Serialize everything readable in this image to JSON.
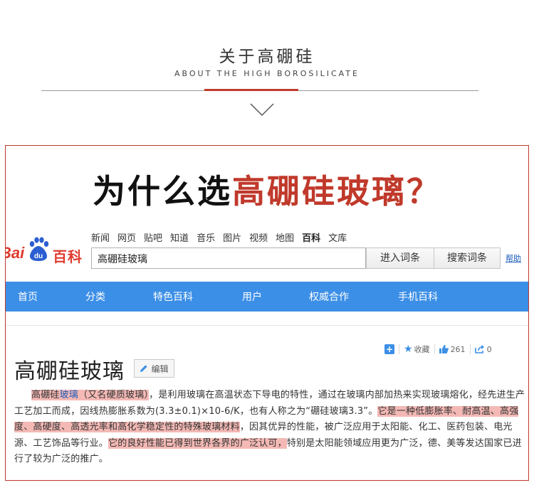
{
  "header": {
    "title": "关于高硼硅",
    "subtitle": "ABOUT THE HIGH BOROSILICATE"
  },
  "question": {
    "prefix": "为什么选",
    "highlight": "高硼硅玻璃？"
  },
  "baidu": {
    "logo_left": "Bai",
    "logo_paw_text": "du",
    "logo_right": "百科",
    "nav_links": [
      "新闻",
      "网页",
      "贴吧",
      "知道",
      "音乐",
      "图片",
      "视频",
      "地图",
      "百科",
      "文库"
    ],
    "active_nav": "百科",
    "search_value": "高硼硅玻璃",
    "enter_button": "进入词条",
    "search_button": "搜索词条",
    "help_link": "帮助",
    "blue_nav": [
      "首页",
      "分类",
      "特色百科",
      "用户",
      "权威合作",
      "手机百科"
    ]
  },
  "entry": {
    "title": "高硼硅玻璃",
    "edit_label": "编辑",
    "favorite_label": "收藏",
    "like_count": "261",
    "share_count": "0",
    "segments": {
      "s1a": "高硼硅",
      "s1b": "玻璃",
      "s1c": "（又名硬质玻璃）",
      "s2": "，是利用玻璃在高温状态下导电的特性，通过在玻璃内部加热来实现玻璃熔化，经先进生产工艺加工而成，因线热膨胀系数为(3.3±0.1)×10-6/K，也有人称之为“硼硅玻璃3.3”。",
      "s3": "它是一种低膨胀率、耐高温、高强度、高硬度、高透光率和高化学稳定性的特殊玻璃材料",
      "s4": "，因其优异的性能，被广泛应用于太阳能、化工、医药包装、电光源、工艺饰品等行业。",
      "s5": "它的良好性能已得到世界各界的广泛认可，",
      "s6": "特别是太阳能领域应用更为广泛，德、美等发达国家已进行了较为广泛的推广。"
    }
  },
  "colors": {
    "accent_red": "#c0392b",
    "baidu_blue": "#3c8fe6",
    "highlight_pink": "#f4b9b5"
  }
}
